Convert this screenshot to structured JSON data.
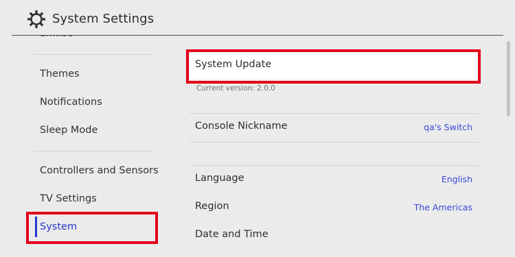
{
  "header": {
    "title": "System Settings",
    "icon": "gear-icon"
  },
  "sidebar": {
    "partial_item": "amiibo",
    "items": [
      {
        "label": "Themes"
      },
      {
        "label": "Notifications"
      },
      {
        "label": "Sleep Mode"
      },
      {
        "label": "Controllers and Sensors"
      },
      {
        "label": "TV Settings"
      },
      {
        "label": "System",
        "selected": true
      }
    ]
  },
  "content": {
    "system_update": {
      "label": "System Update",
      "caption": "Current version: 2.0.0"
    },
    "console_nickname": {
      "label": "Console Nickname",
      "value": "qa's Switch"
    },
    "language": {
      "label": "Language",
      "value": "English"
    },
    "region": {
      "label": "Region",
      "value": "The Americas"
    },
    "date_time": {
      "label": "Date and Time"
    }
  },
  "colors": {
    "accent": "#2a35d1",
    "highlight_box": "#e2001a",
    "background": "#ebebeb"
  }
}
